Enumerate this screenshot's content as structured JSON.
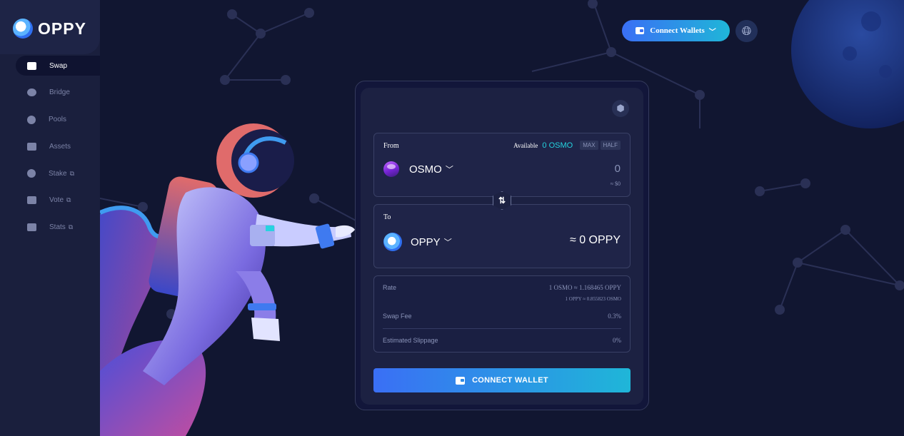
{
  "brand": {
    "name": "OPPY"
  },
  "sidebar": {
    "items": [
      {
        "label": "Swap",
        "icon": "swap-icon",
        "external": false,
        "active": true
      },
      {
        "label": "Bridge",
        "icon": "bridge-icon",
        "external": false,
        "active": false
      },
      {
        "label": "Pools",
        "icon": "pools-icon",
        "external": false,
        "active": false
      },
      {
        "label": "Assets",
        "icon": "assets-icon",
        "external": false,
        "active": false
      },
      {
        "label": "Stake",
        "icon": "stake-icon",
        "external": true,
        "active": false
      },
      {
        "label": "Vote",
        "icon": "vote-icon",
        "external": true,
        "active": false
      },
      {
        "label": "Stats",
        "icon": "stats-icon",
        "external": true,
        "active": false
      }
    ]
  },
  "header": {
    "connect_label": "Connect Wallets",
    "globe_icon": "globe-icon"
  },
  "swap": {
    "from": {
      "label": "From",
      "available_label": "Available",
      "available_value": "0 OSMO",
      "max_label": "MAX",
      "half_label": "HALF",
      "token": "OSMO",
      "amount": "0",
      "usd": "≈ $0"
    },
    "to": {
      "label": "To",
      "token": "OPPY",
      "amount": "≈ 0 OPPY"
    },
    "info": {
      "rate_label": "Rate",
      "rate_primary": "1 OSMO ≈ 1.168465 OPPY",
      "rate_secondary": "1 OPPY ≈ 0.855823 OSMO",
      "fee_label": "Swap Fee",
      "fee_value": "0.3%",
      "slippage_label": "Estimated Slippage",
      "slippage_value": "0%"
    },
    "connect_button": "CONNECT WALLET"
  },
  "colors": {
    "accent_start": "#3a6ff5",
    "accent_end": "#1fb6d8",
    "available": "#24d3e0",
    "background": "#111631"
  }
}
